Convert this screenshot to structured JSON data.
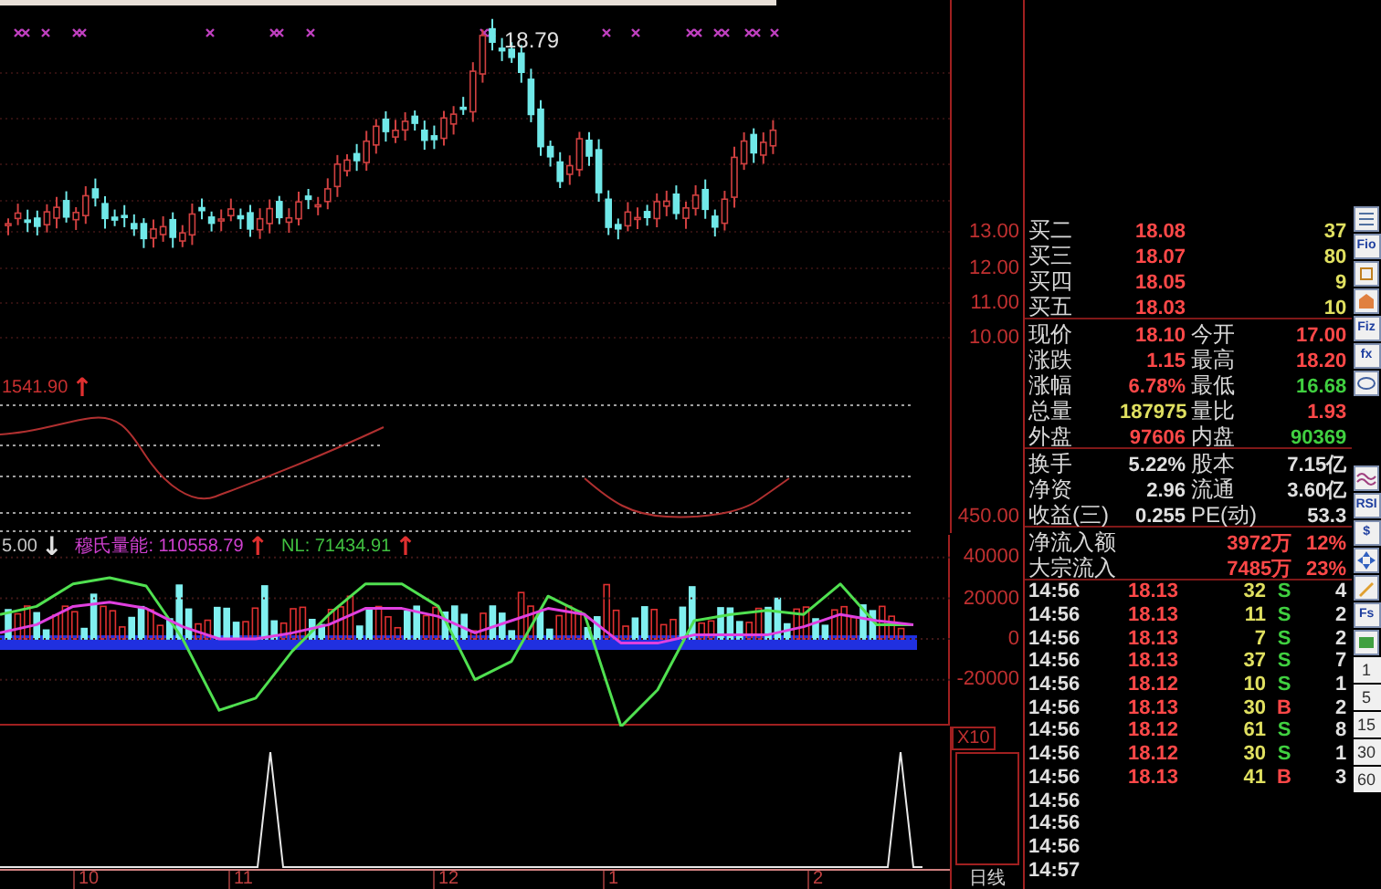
{
  "price_chart": {
    "peak_label": "18.79",
    "axis_ticks": [
      "13.00",
      "12.00",
      "11.00",
      "10.00"
    ]
  },
  "indicator_1": {
    "readings": [
      {
        "text": "1541.90",
        "color": "#c83030",
        "arrow": {
          "text": "↑",
          "color": "#e03030"
        }
      }
    ],
    "axis_ticks": [
      "450.00"
    ]
  },
  "indicator_2": {
    "readings": [
      {
        "text": "5.00",
        "color": "#c8c8c8",
        "arrow": {
          "text": "↓",
          "color": "#e0e0e0"
        }
      },
      {
        "text": "穆氏量能: 110558.79",
        "color": "#d040d0",
        "arrow": {
          "text": "↑",
          "color": "#e03030"
        }
      },
      {
        "text": "NL: 71434.91",
        "color": "#40c040",
        "arrow": {
          "text": "↑",
          "color": "#e03030"
        }
      }
    ],
    "chart_data": {
      "type": "line",
      "grid": true,
      "ylim": [
        -43000,
        52000
      ],
      "yticks": [
        40000,
        20000,
        0,
        -20000
      ],
      "series": [
        {
          "color": "#50e050",
          "values": [
            12000,
            16000,
            27000,
            30000,
            26000,
            0,
            -35000,
            -29000,
            -6000,
            12000,
            27000,
            27000,
            16000,
            -20000,
            -11000,
            21000,
            12000,
            -43000,
            -25000,
            9000,
            12000,
            14000,
            12000,
            27000,
            7000,
            7000
          ]
        },
        {
          "color": "#e040e0",
          "values": [
            3000,
            7000,
            16000,
            18000,
            15000,
            6000,
            0,
            0,
            3000,
            7000,
            15000,
            15000,
            11000,
            3000,
            9000,
            15000,
            12000,
            -2000,
            -2000,
            2000,
            2000,
            2000,
            6000,
            12000,
            9000,
            7000
          ]
        }
      ]
    }
  },
  "indicator_3": {
    "scale_label": "X10"
  },
  "x_axis": {
    "ticks": [
      "10",
      "11",
      "12",
      "1",
      "2"
    ],
    "period_label": "日线"
  },
  "order_book": [
    {
      "label": "买二",
      "price": "18.08",
      "volume": "37"
    },
    {
      "label": "买三",
      "price": "18.07",
      "volume": "80"
    },
    {
      "label": "买四",
      "price": "18.05",
      "volume": "9"
    },
    {
      "label": "买五",
      "price": "18.03",
      "volume": "10"
    }
  ],
  "quote": [
    [
      {
        "label": "现价",
        "value": "18.10",
        "color": "#ff4848"
      },
      {
        "label": "今开",
        "value": "17.00",
        "color": "#ff4848"
      }
    ],
    [
      {
        "label": "涨跌",
        "value": "1.15",
        "color": "#ff4848"
      },
      {
        "label": "最高",
        "value": "18.20",
        "color": "#ff4848"
      }
    ],
    [
      {
        "label": "涨幅",
        "value": "6.78%",
        "color": "#ff4848"
      },
      {
        "label": "最低",
        "value": "16.68",
        "color": "#40d040"
      }
    ],
    [
      {
        "label": "总量",
        "value": "187975",
        "color": "#e0e060"
      },
      {
        "label": "量比",
        "value": "1.93",
        "color": "#ff4848"
      }
    ],
    [
      {
        "label": "外盘",
        "value": "97606",
        "color": "#ff4848"
      },
      {
        "label": "内盘",
        "value": "90369",
        "color": "#40d040"
      }
    ]
  ],
  "stats": [
    [
      {
        "label": "换手",
        "value": "5.22%"
      },
      {
        "label": "股本",
        "value": "7.15亿"
      }
    ],
    [
      {
        "label": "净资",
        "value": "2.96"
      },
      {
        "label": "流通",
        "value": "3.60亿"
      }
    ],
    [
      {
        "label": "收益(三)",
        "value": "0.255"
      },
      {
        "label": "PE(动)",
        "value": "53.3"
      }
    ]
  ],
  "flows": [
    {
      "label": "净流入额",
      "amount": "3972万",
      "percent": "12%"
    },
    {
      "label": "大宗流入",
      "amount": "7485万",
      "percent": "23%"
    }
  ],
  "ticks": [
    {
      "time": "14:56",
      "price": "18.13",
      "volume": "32",
      "side": "S",
      "count": "4"
    },
    {
      "time": "14:56",
      "price": "18.13",
      "volume": "11",
      "side": "S",
      "count": "2"
    },
    {
      "time": "14:56",
      "price": "18.13",
      "volume": "7",
      "side": "S",
      "count": "2"
    },
    {
      "time": "14:56",
      "price": "18.13",
      "volume": "37",
      "side": "S",
      "count": "7"
    },
    {
      "time": "14:56",
      "price": "18.12",
      "volume": "10",
      "side": "S",
      "count": "1"
    },
    {
      "time": "14:56",
      "price": "18.13",
      "volume": "30",
      "side": "B",
      "count": "2"
    },
    {
      "time": "14:56",
      "price": "18.12",
      "volume": "61",
      "side": "S",
      "count": "8"
    },
    {
      "time": "14:56",
      "price": "18.12",
      "volume": "30",
      "side": "S",
      "count": "1"
    },
    {
      "time": "14:56",
      "price": "18.13",
      "volume": "41",
      "side": "B",
      "count": "3"
    },
    {
      "time": "14:56"
    },
    {
      "time": "14:56"
    },
    {
      "time": "14:56"
    },
    {
      "time": "14:57"
    }
  ],
  "toolbar_labels": [
    "Fio",
    "Fiz",
    "fx",
    "RSI",
    "$",
    "Fs"
  ],
  "period_buttons": [
    "1",
    "5",
    "15",
    "30",
    "60"
  ]
}
